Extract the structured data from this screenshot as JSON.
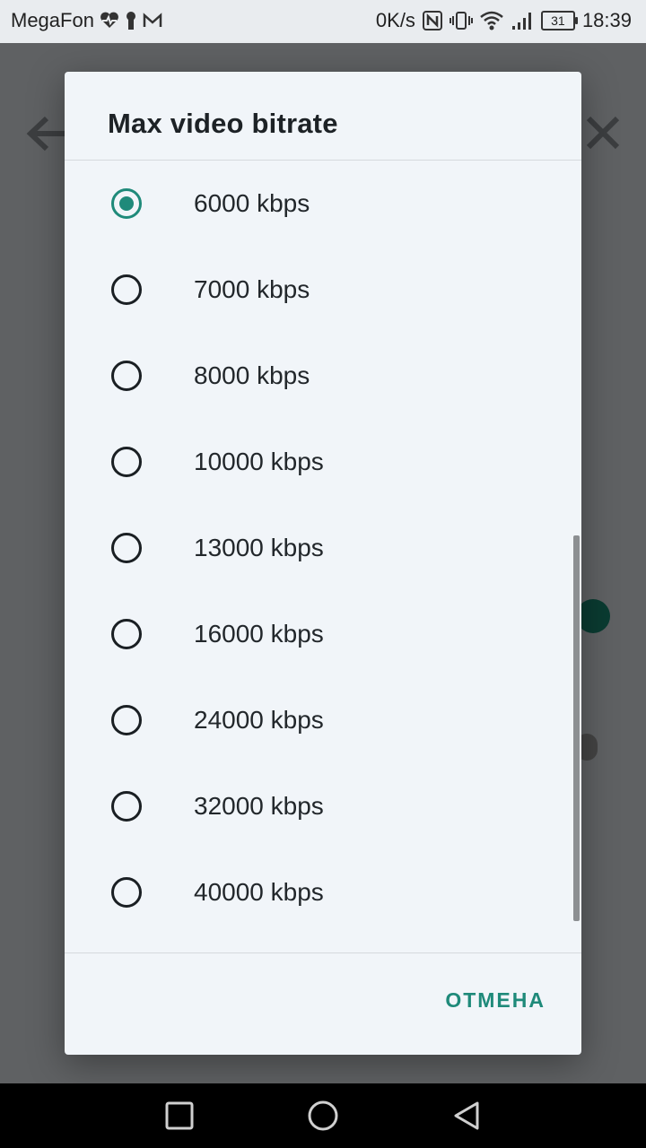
{
  "status_bar": {
    "carrier": "MegaFon",
    "net_speed": "0K/s",
    "battery": "31",
    "time": "18:39",
    "icons": [
      "heart-pulse-icon",
      "keyhole-icon",
      "mail-icon",
      "nfc-icon",
      "vibrate-icon",
      "wifi-icon",
      "signal-icon",
      "battery-icon"
    ]
  },
  "dialog": {
    "title": "Max video bitrate",
    "options": [
      {
        "label": "6000 kbps",
        "selected": true
      },
      {
        "label": "7000 kbps",
        "selected": false
      },
      {
        "label": "8000 kbps",
        "selected": false
      },
      {
        "label": "10000 kbps",
        "selected": false
      },
      {
        "label": "13000 kbps",
        "selected": false
      },
      {
        "label": "16000 kbps",
        "selected": false
      },
      {
        "label": "24000 kbps",
        "selected": false
      },
      {
        "label": "32000 kbps",
        "selected": false
      },
      {
        "label": "40000 kbps",
        "selected": false
      }
    ],
    "cancel_label": "ОТМЕНА"
  },
  "colors": {
    "accent": "#1f8a7a",
    "dialog_bg": "#f1f5f9",
    "scrim": "#5f6163"
  },
  "nav_bar": {
    "icons": [
      "recents-square-icon",
      "home-circle-icon",
      "back-triangle-icon"
    ]
  }
}
